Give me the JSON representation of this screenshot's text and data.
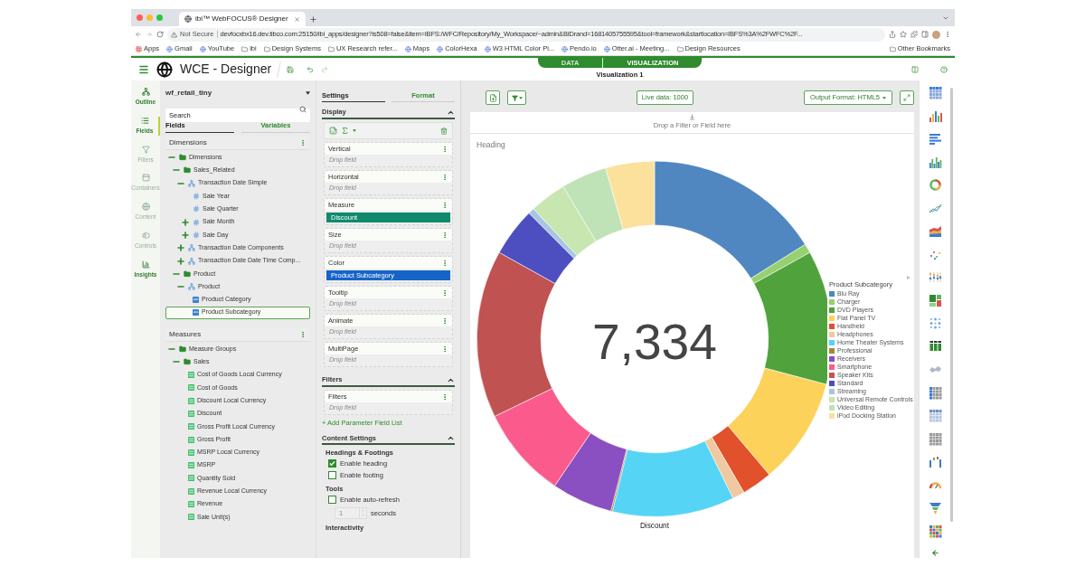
{
  "browser": {
    "tab_title": "ibi™ WebFOCUS® Designer",
    "security": "Not Secure",
    "url": "devfocxbx16.dev.tibco.com:25150/ibi_apps/designer?is508=false&item=IBFS:/WFC/Repository/My_Workspace/~admin&BIDrand=1681405755595&tool=framework&startlocation=IBFS%3A%2FWFC%2F...",
    "bookmarks": [
      {
        "label": "Apps",
        "kind": "apps"
      },
      {
        "label": "Gmail",
        "kind": "site"
      },
      {
        "label": "YouTube",
        "kind": "site"
      },
      {
        "label": "ibi",
        "kind": "folder"
      },
      {
        "label": "Design Systems",
        "kind": "folder"
      },
      {
        "label": "UX Research refer...",
        "kind": "folder"
      },
      {
        "label": "Maps",
        "kind": "site"
      },
      {
        "label": "ColorHexa",
        "kind": "site"
      },
      {
        "label": "W3 HTML Color Pi...",
        "kind": "site"
      },
      {
        "label": "Pendo.io",
        "kind": "site"
      },
      {
        "label": "Otter.ai - Meeting...",
        "kind": "site"
      },
      {
        "label": "Design Resources",
        "kind": "folder"
      }
    ],
    "other_bookmarks": "Other Bookmarks"
  },
  "app": {
    "title": "WCE - Designer",
    "mode_tabs": [
      {
        "label": "DATA",
        "selected": false
      },
      {
        "label": "VISUALIZATION",
        "selected": true
      }
    ],
    "subtitle": "Visualization 1"
  },
  "rail": [
    {
      "label": "Outline",
      "selected": false,
      "disabled": false
    },
    {
      "label": "Fields",
      "selected": true,
      "disabled": false
    },
    {
      "label": "Filters",
      "selected": false,
      "disabled": true
    },
    {
      "label": "Containers",
      "selected": false,
      "disabled": true
    },
    {
      "label": "Content",
      "selected": false,
      "disabled": true
    },
    {
      "label": "Controls",
      "selected": false,
      "disabled": true
    },
    {
      "label": "Insights",
      "selected": false,
      "disabled": false
    }
  ],
  "fields_panel": {
    "source": "wf_retail_tiny",
    "search": {
      "placeholder": "Search"
    },
    "tabs": [
      {
        "label": "Fields",
        "selected": true
      },
      {
        "label": "Variables",
        "selected": false
      }
    ],
    "sections": [
      {
        "title": "Dimensions",
        "tree": [
          {
            "label": "Dimensions",
            "kind": "folder",
            "expanded": true,
            "selected": false,
            "children": [
              {
                "label": "Sales_Related",
                "kind": "folder",
                "expanded": true,
                "selected": false,
                "children": [
                  {
                    "label": "Transaction Date Simple",
                    "kind": "hierarchy",
                    "expanded": true,
                    "selected": false,
                    "children": [
                      {
                        "label": "Sale Year",
                        "kind": "number",
                        "selected": false
                      },
                      {
                        "label": "Sale Quarter",
                        "kind": "number",
                        "selected": false
                      },
                      {
                        "label": "Sale Month",
                        "kind": "number",
                        "expanded": false,
                        "selected": false
                      },
                      {
                        "label": "Sale Day",
                        "kind": "number",
                        "expanded": false,
                        "selected": false
                      }
                    ]
                  },
                  {
                    "label": "Transaction Date Components",
                    "kind": "hierarchy",
                    "expanded": false,
                    "selected": false
                  },
                  {
                    "label": "Transaction Date Date Time Comp...",
                    "kind": "hierarchy",
                    "expanded": false,
                    "selected": false
                  }
                ]
              },
              {
                "label": "Product",
                "kind": "folder",
                "expanded": true,
                "selected": false,
                "children": [
                  {
                    "label": "Product",
                    "kind": "hierarchy",
                    "expanded": true,
                    "selected": false,
                    "children": [
                      {
                        "label": "Product Category",
                        "kind": "dimension",
                        "selected": false
                      },
                      {
                        "label": "Product Subcategory",
                        "kind": "dimension",
                        "selected": true
                      }
                    ]
                  }
                ]
              }
            ]
          }
        ]
      },
      {
        "title": "Measures",
        "tree": [
          {
            "label": "Measure Groups",
            "kind": "folder",
            "expanded": true,
            "selected": false,
            "children": [
              {
                "label": "Sales",
                "kind": "folder",
                "expanded": true,
                "selected": false,
                "children": [
                  {
                    "label": "Cost of Goods Local Currency",
                    "kind": "measure",
                    "selected": false
                  },
                  {
                    "label": "Cost of Goods",
                    "kind": "measure",
                    "selected": false
                  },
                  {
                    "label": "Discount Local Currency",
                    "kind": "measure",
                    "selected": false
                  },
                  {
                    "label": "Discount",
                    "kind": "measure",
                    "selected": false
                  },
                  {
                    "label": "Gross Profit Local Currency",
                    "kind": "measure",
                    "selected": false
                  },
                  {
                    "label": "Gross Profit",
                    "kind": "measure",
                    "selected": false
                  },
                  {
                    "label": "MSRP Local Currency",
                    "kind": "measure",
                    "selected": false
                  },
                  {
                    "label": "MSRP",
                    "kind": "measure",
                    "selected": false
                  },
                  {
                    "label": "Quantity Sold",
                    "kind": "measure",
                    "selected": false
                  },
                  {
                    "label": "Revenue Local Currency",
                    "kind": "measure",
                    "selected": false
                  },
                  {
                    "label": "Revenue",
                    "kind": "measure",
                    "selected": false
                  },
                  {
                    "label": "Sale Unit(s)",
                    "kind": "measure",
                    "selected": false
                  }
                ]
              }
            ]
          }
        ]
      }
    ]
  },
  "settings_panel": {
    "tabs": [
      {
        "label": "Settings",
        "selected": true
      },
      {
        "label": "Format",
        "selected": false
      }
    ],
    "display": {
      "title": "Display",
      "buckets": [
        {
          "label": "Vertical",
          "placeholder": "Drop field"
        },
        {
          "label": "Horizontal",
          "placeholder": "Drop field"
        },
        {
          "label": "Measure",
          "field": {
            "label": "Discount",
            "kind": "measure"
          }
        },
        {
          "label": "Size",
          "placeholder": "Drop field"
        },
        {
          "label": "Color",
          "field": {
            "label": "Product Subcategory",
            "kind": "dimension"
          }
        },
        {
          "label": "Tooltip",
          "placeholder": "Drop field"
        },
        {
          "label": "Animate",
          "placeholder": "Drop field"
        },
        {
          "label": "MultiPage",
          "placeholder": "Drop field"
        }
      ]
    },
    "filters": {
      "title": "Filters",
      "buckets": [
        {
          "label": "Filters",
          "placeholder": "Drop field"
        }
      ]
    },
    "add_link": "+ Add Parameter Field List",
    "content_settings": {
      "title": "Content Settings",
      "groups": [
        {
          "title": "Headings & Footings",
          "options": [
            {
              "label": "Enable heading",
              "checked": true
            },
            {
              "label": "Enable footing",
              "checked": false
            }
          ]
        },
        {
          "title": "Tools",
          "options": [
            {
              "label": "Enable auto-refresh",
              "checked": false
            }
          ],
          "interval": {
            "value": "1",
            "unit": "seconds",
            "disabled": true
          }
        },
        {
          "title": "Interactivity"
        }
      ]
    }
  },
  "canvas": {
    "live_data": "Live data: 1000",
    "output_format": "Output Format: HTML5",
    "drop_zone": "Drop a Filter or Field here",
    "heading": "Heading",
    "center_value": "7,334",
    "axis_label": "Discount",
    "legend": {
      "title": "Product Subcategory",
      "items": [
        {
          "label": "Blu Ray",
          "color": "#5087c1"
        },
        {
          "label": "Charger",
          "color": "#97d070"
        },
        {
          "label": "DVD Players",
          "color": "#4fa23c"
        },
        {
          "label": "Flat Panel TV",
          "color": "#fdd25a"
        },
        {
          "label": "Handheld",
          "color": "#e0512c"
        },
        {
          "label": "Headphones",
          "color": "#f0c9a0"
        },
        {
          "label": "Home Theater Systems",
          "color": "#56d4f6"
        },
        {
          "label": "Professional",
          "color": "#a08a3a"
        },
        {
          "label": "Receivers",
          "color": "#8a4fc0"
        },
        {
          "label": "Smartphone",
          "color": "#fa5b8c"
        },
        {
          "label": "Speaker Kits",
          "color": "#c05252"
        },
        {
          "label": "Standard",
          "color": "#4d4fc0"
        },
        {
          "label": "Streaming",
          "color": "#a9c4e4"
        },
        {
          "label": "Universal Remote Controls",
          "color": "#c8e6b0"
        },
        {
          "label": "Video Editing",
          "color": "#bfe3b6"
        },
        {
          "label": "iPod Docking Station",
          "color": "#fbe19c"
        }
      ]
    }
  }
}
